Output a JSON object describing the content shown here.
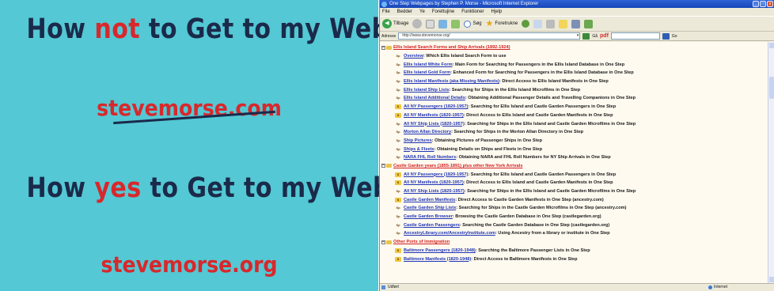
{
  "slide": {
    "headline1_pre": "How ",
    "headline1_highlight": "not",
    "headline1_post": " to Get to my Website",
    "site_struck": "stevemorse.com",
    "headline2_pre": "How ",
    "headline2_highlight": "yes",
    "headline2_post": " to Get to my Website",
    "site_good": "stevemorse.org"
  },
  "browser": {
    "title": "One Step Webpages by Stephen P. Morse - Microsoft Internet Explorer",
    "window_buttons": [
      "_",
      "□",
      "x"
    ],
    "menu": [
      "File",
      "Bedder",
      "Ye",
      "Forettujine",
      "Funktioner",
      "Hjelp"
    ],
    "toolbar": {
      "back_label": "Tilbage",
      "search_label": "Søg",
      "favorites_label": "Foretrukne"
    },
    "address": {
      "label": "Adresse",
      "url": "http://www.stevemorse.org/",
      "go_label": "Gå",
      "pdf_label": "pdf",
      "right_go_label": "Go"
    },
    "sections": [
      {
        "title": "Ellis Island Search Forms and Ship Arrivals (1892-1924)",
        "items": [
          {
            "badge": "Sp",
            "link": "Overview",
            "desc": ": Which Ellis Island Search Form to use"
          },
          {
            "badge": "Sp",
            "link": "Ellis Island White Form",
            "desc": ": Main Form for Searching for Passengers in the Ellis Island Database in One Step"
          },
          {
            "badge": "Sp",
            "link": "Ellis Island Gold Form",
            "desc": ": Enhanced Form for Searching for Passengers in the Ellis Island Database in One Step"
          },
          {
            "badge": "Sp",
            "link": "Ellis Island Manifests (aka Missing Manifests)",
            "desc": ": Direct Access to Ellis Island Manifests in One Step"
          },
          {
            "badge": "Sp",
            "link": "Ellis Island Ship Lists",
            "desc": ": Searching for Ships in the Ellis Island Microfilms in One Step"
          },
          {
            "badge": "Sp",
            "link": "Ellis Island Additional Details",
            "desc": ": Obtaining Additional Passenger Details and Travelling Companions in One Step"
          },
          {
            "badge": "$",
            "link": "All NY Passengers (1820-1957)",
            "desc": ": Searching for Ellis Island and Castle Garden Passengers in One Step"
          },
          {
            "badge": "$",
            "link": "All NY Manifests (1820-1957)",
            "desc": ": Direct Access to Ellis Island and Castle Garden Manifests in One Step"
          },
          {
            "badge": "Sp",
            "link": "All NY Ship Lists (1820-1957)",
            "desc": ": Searching for Ships in the Ellis Island and Castle Garden Microfilms in One Step"
          },
          {
            "badge": "Sp",
            "link": "Morton Allan Directory",
            "desc": ": Searching for Ships in the Morton Allan Directory in One Step"
          },
          {
            "badge": "Sp",
            "link": "Ship Pictures",
            "desc": ": Obtaining Pictures of Passenger Ships in One Step"
          },
          {
            "badge": "Sp",
            "link": "Ships & Fleets",
            "desc": ": Obtaining Details on Ships and Fleets in One Step"
          },
          {
            "badge": "Sp",
            "link": "NARA FHL Roll Numbers",
            "desc": ": Obtaining NARA and FHL Roll Numbers for NY Ship Arrivals in One Step"
          }
        ]
      },
      {
        "title": "Castle Garden years (1855-1891) plus other New York Arrivals",
        "items": [
          {
            "badge": "$",
            "link": "All NY Passengers (1820-1957)",
            "desc": ": Searching for Ellis Island and Castle Garden Passengers in One Step"
          },
          {
            "badge": "$",
            "link": "All NY Manifests (1820-1957)",
            "desc": ": Direct Access to Ellis Island and Castle Garden Manifests in One Step"
          },
          {
            "badge": "Sp",
            "link": "All NY Ship Lists (1820-1957)",
            "desc": ": Searching for Ships in the Ellis Island and Castle Garden Microfilms in One Step"
          },
          {
            "badge": "$",
            "link": "Castle Garden Manifests",
            "desc": ": Direct Access to Castle Garden Manifests in One Step (ancestry.com)"
          },
          {
            "badge": "Sp",
            "link": "Castle Garden Ship Lists",
            "desc": ": Searching for Ships in the Castle Garden Microfilms in One Step (ancestry.com)"
          },
          {
            "badge": "Sp",
            "link": "Castle Garden Browser",
            "desc": ": Browsing the Castle Garden Database in One Step (castlegarden.org)"
          },
          {
            "badge": "Sp",
            "link": "Castle Garden Passengers",
            "desc": ": Searching the Castle Garden Database in One Step (castlegarden.org)"
          },
          {
            "badge": "Sp",
            "link": "AncestryLibrary.com/AncestryInstitute.com",
            "desc": ": Using Ancestry from a library or institute in One Step"
          }
        ]
      },
      {
        "title": "Other Ports of Immigration",
        "items": [
          {
            "badge": "$",
            "link": "Baltimore Passengers (1820-1948)",
            "desc": ": Searching the Baltimore Passenger Lists in One Step"
          },
          {
            "badge": "$",
            "link": "Baltimore Manifests (1820-1948)",
            "desc": ": Direct Access to Baltimore Manifests in One Step"
          }
        ]
      }
    ],
    "status": {
      "left": "Udført",
      "zone": "Internet"
    }
  }
}
